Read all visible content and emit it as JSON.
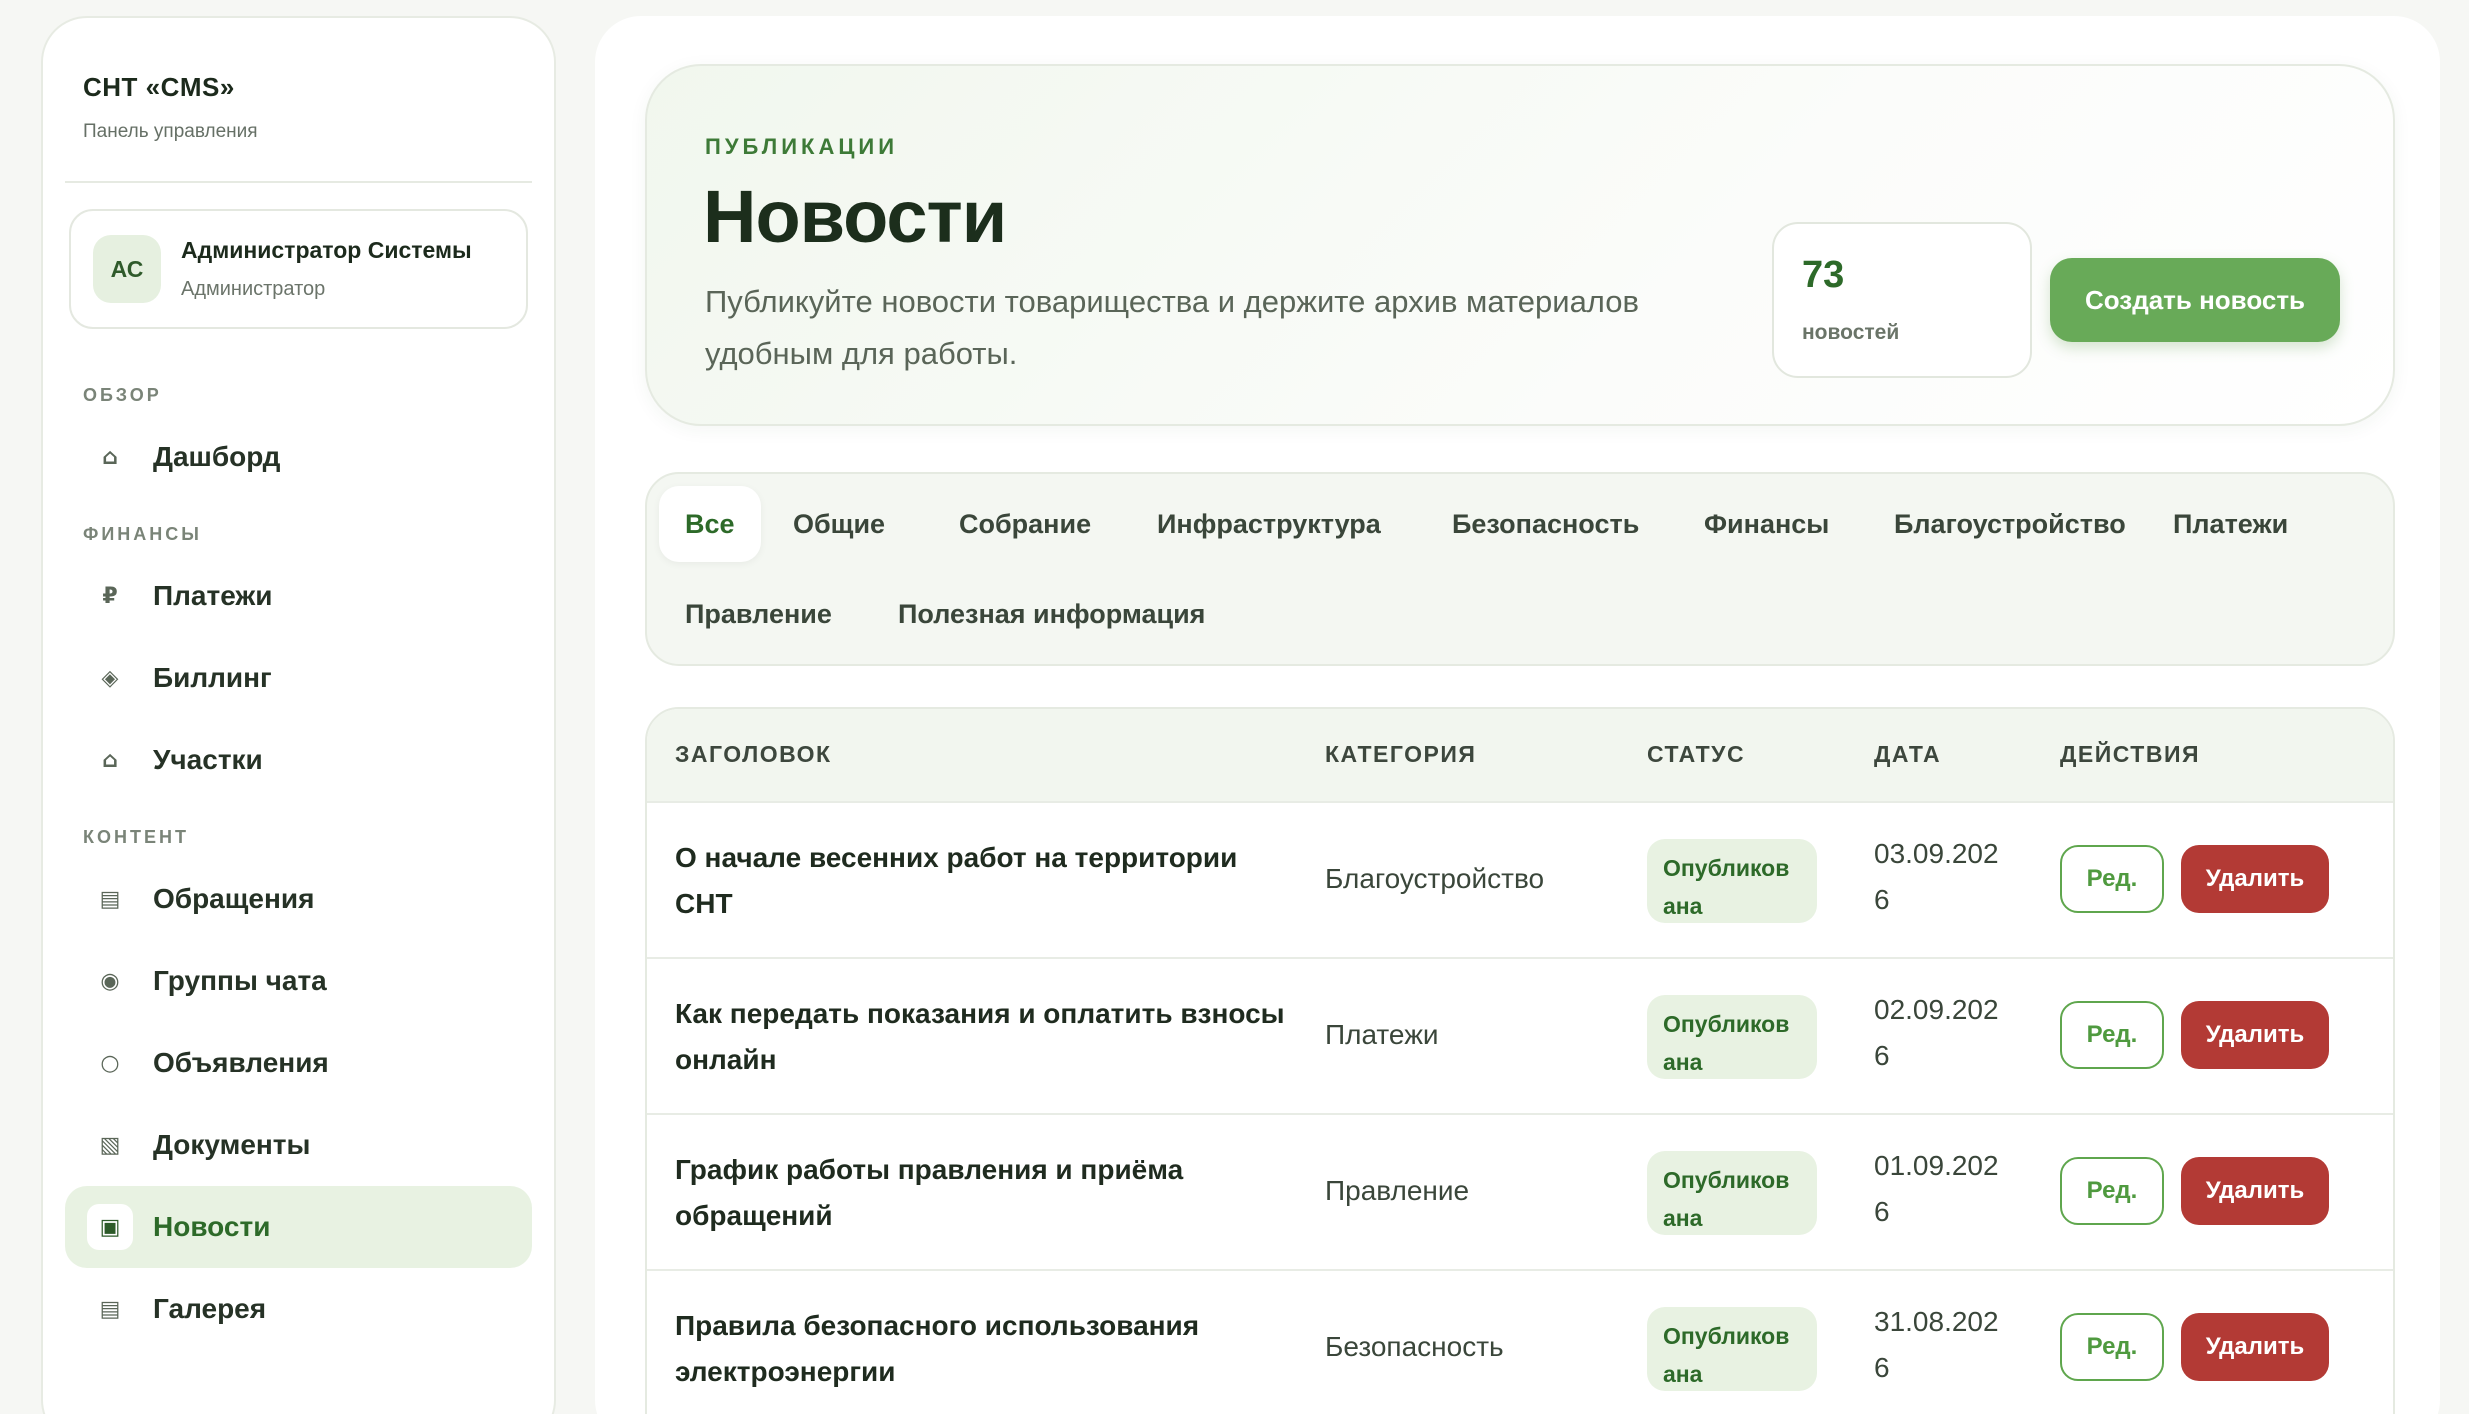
{
  "sidebar": {
    "brand_title": "СНТ «CMS»",
    "brand_subtitle": "Панель управления",
    "user": {
      "initials": "АС",
      "name": "Администратор Системы",
      "role": "Администратор"
    },
    "sections": {
      "overview": "ОБЗОР",
      "finance": "ФИНАНСЫ",
      "content": "КОНТЕНТ"
    },
    "items": [
      {
        "label": "Дашборд",
        "icon": "⌂",
        "icon_name": "home-icon"
      },
      {
        "label": "Платежи",
        "icon": "₽",
        "icon_name": "ruble-icon"
      },
      {
        "label": "Биллинг",
        "icon": "◈",
        "icon_name": "billing-icon"
      },
      {
        "label": "Участки",
        "icon": "⌂",
        "icon_name": "plots-icon"
      },
      {
        "label": "Обращения",
        "icon": "▤",
        "icon_name": "requests-icon"
      },
      {
        "label": "Группы чата",
        "icon": "◉",
        "icon_name": "chat-groups-icon"
      },
      {
        "label": "Объявления",
        "icon": "○",
        "icon_name": "announcements-icon"
      },
      {
        "label": "Документы",
        "icon": "▧",
        "icon_name": "documents-icon"
      },
      {
        "label": "Новости",
        "icon": "▣",
        "icon_name": "news-icon"
      },
      {
        "label": "Галерея",
        "icon": "▤",
        "icon_name": "gallery-icon"
      }
    ],
    "active_item": "Новости"
  },
  "hero": {
    "eyebrow": "ПУБЛИКАЦИИ",
    "title": "Новости",
    "description": "Публикуйте новости товарищества и держите архив материалов удобным для работы.",
    "stat_value": "73",
    "stat_label": "новостей",
    "create_label": "Создать новость"
  },
  "tabs": [
    "Все",
    "Общие",
    "Собрание",
    "Инфраструктура",
    "Безопасность",
    "Финансы",
    "Благоустройство",
    "Платежи",
    "Правление",
    "Полезная информация"
  ],
  "active_tab": "Все",
  "table": {
    "headers": {
      "title": "ЗАГОЛОВОК",
      "category": "КАТЕГОРИЯ",
      "status": "СТАТУС",
      "date": "ДАТА",
      "actions": "ДЕЙСТВИЯ"
    },
    "edit_label": "Ред.",
    "delete_label": "Удалить",
    "rows": [
      {
        "title": "О начале весенних работ на территории СНТ",
        "category": "Благоустройство",
        "status": "Опубликована",
        "date": "03.09.2026"
      },
      {
        "title": "Как передать показания и оплатить взносы онлайн",
        "category": "Платежи",
        "status": "Опубликована",
        "date": "02.09.2026"
      },
      {
        "title": "График работы правления и приёма обращений",
        "category": "Правление",
        "status": "Опубликована",
        "date": "01.09.2026"
      },
      {
        "title": "Правила безопасного использования электроэнергии",
        "category": "Безопасность",
        "status": "Опубликована",
        "date": "31.08.2026"
      }
    ]
  },
  "colors": {
    "accent": "#68aa58",
    "accent_dark": "#2d6a29",
    "danger": "#b33a35",
    "badge_bg": "#e8f2e2"
  }
}
